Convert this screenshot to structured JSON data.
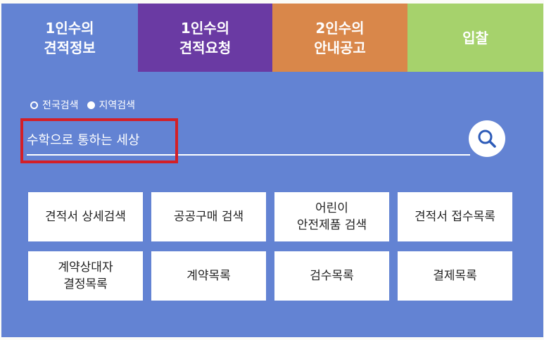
{
  "tabs": [
    {
      "label": "1인수의\n견적정보"
    },
    {
      "label": "1인수의\n견적요청"
    },
    {
      "label": "2인수의\n안내공고"
    },
    {
      "label": "입찰"
    }
  ],
  "scope": {
    "option1": "전국검색",
    "option2": "지역검색",
    "selected": "전국검색"
  },
  "search": {
    "value": "수학으로 통하는 세상",
    "icon": "search-icon"
  },
  "buttons": [
    {
      "label": "견적서 상세검색"
    },
    {
      "label": "공공구매 검색"
    },
    {
      "label": "어린이\n안전제품 검색"
    },
    {
      "label": "견적서 접수목록"
    },
    {
      "label": "계약상대자\n결정목록"
    },
    {
      "label": "계약목록"
    },
    {
      "label": "검수목록"
    },
    {
      "label": "결제목록"
    }
  ],
  "colors": {
    "panel": "#6383d3",
    "tab2": "#6a3aa3",
    "tab3": "#d9874a",
    "tab4": "#a6d26c",
    "highlight": "#d41f26"
  }
}
